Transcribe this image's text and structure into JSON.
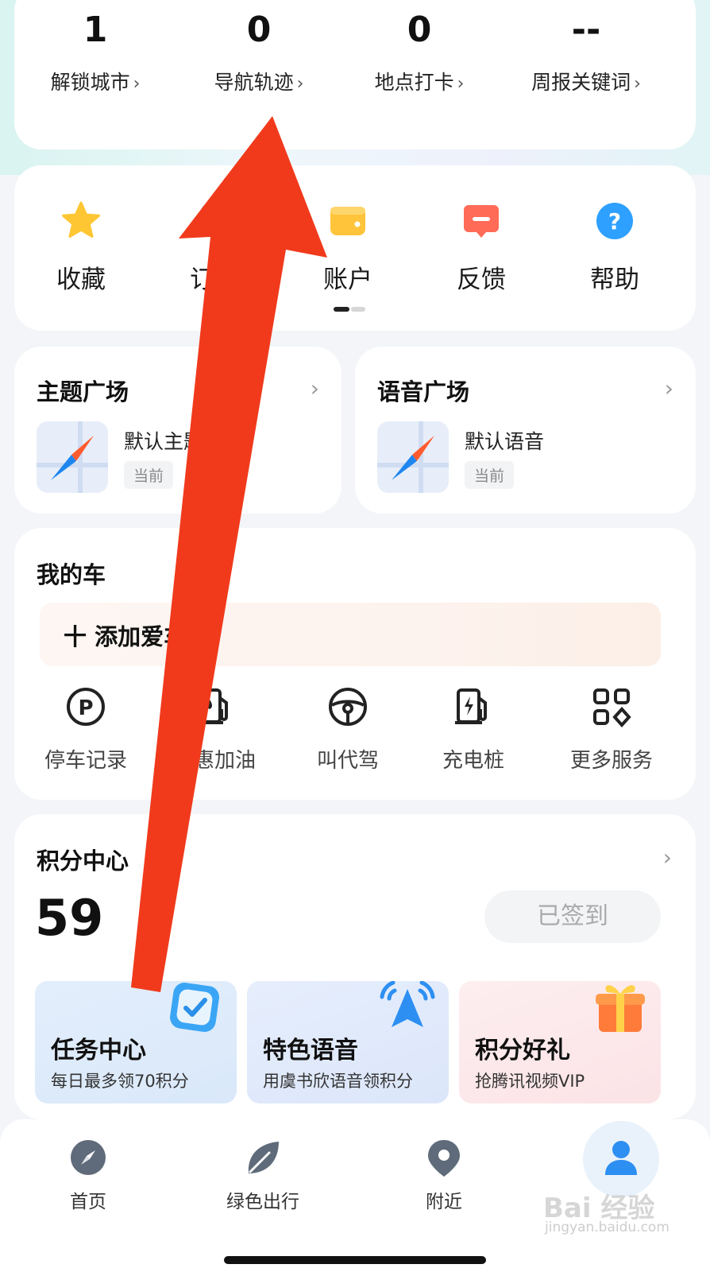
{
  "stats": [
    {
      "value": "1",
      "label": "解锁城市"
    },
    {
      "value": "0",
      "label": "导航轨迹"
    },
    {
      "value": "0",
      "label": "地点打卡"
    },
    {
      "value": "--",
      "label": "周报关键词"
    }
  ],
  "quick_actions": [
    {
      "label": "收藏",
      "icon": "star-icon"
    },
    {
      "label": "订单",
      "icon": "order-icon"
    },
    {
      "label": "账户",
      "icon": "wallet-icon"
    },
    {
      "label": "反馈",
      "icon": "feedback-icon"
    },
    {
      "label": "帮助",
      "icon": "help-icon"
    }
  ],
  "theme": {
    "title": "主题广场",
    "item": "默认主题",
    "badge": "当前"
  },
  "voice": {
    "title": "语音广场",
    "item": "默认语音",
    "badge": "当前"
  },
  "mycar": {
    "title": "我的车",
    "add_label": "十 添加爱车",
    "services": [
      {
        "label": "停车记录",
        "icon": "parking-icon"
      },
      {
        "label": "优惠加油",
        "icon": "fuel-icon"
      },
      {
        "label": "叫代驾",
        "icon": "steering-wheel-icon"
      },
      {
        "label": "充电桩",
        "icon": "charging-icon"
      },
      {
        "label": "更多服务",
        "icon": "grid-icon"
      }
    ]
  },
  "points": {
    "title": "积分中心",
    "score": "59",
    "sign_label": "已签到",
    "tiles": [
      {
        "name": "任务中心",
        "sub": "每日最多领70积分"
      },
      {
        "name": "特色语音",
        "sub": "用虞书欣语音领积分"
      },
      {
        "name": "积分好礼",
        "sub": "抢腾讯视频VIP"
      }
    ]
  },
  "nav": [
    {
      "label": "首页"
    },
    {
      "label": "绿色出行"
    },
    {
      "label": "附近"
    },
    {
      "label": ""
    }
  ],
  "watermark": {
    "brand": "Bai 经验",
    "url": "jingyan.baidu.com"
  },
  "colors": {
    "accent": "#2f8ff0",
    "arrow": "#f13a1c",
    "star": "#ffc633",
    "wallet": "#ffc43a",
    "feedback": "#ff6b57",
    "help": "#2ea0ff"
  }
}
